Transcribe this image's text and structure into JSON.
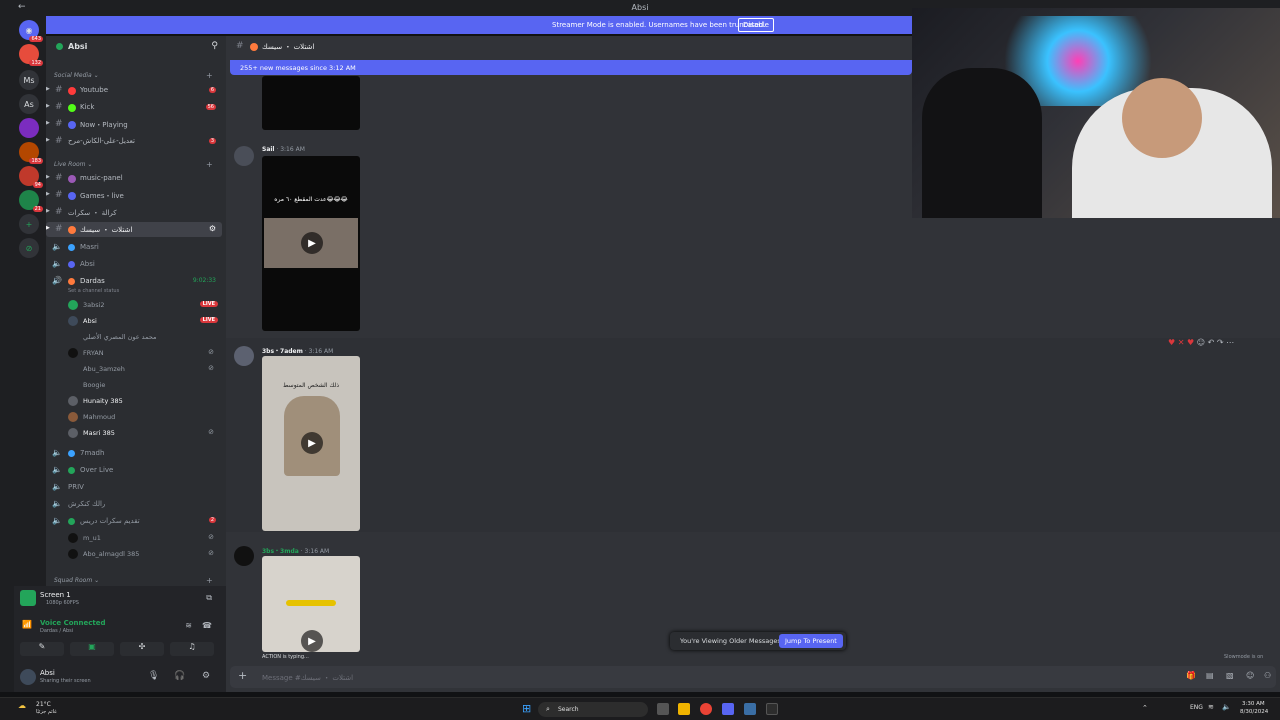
{
  "window": {
    "title": "Absi"
  },
  "streamer_mode": {
    "message": "Streamer Mode is enabled. Usernames have been truncated.",
    "button": "Disable"
  },
  "new_messages": "255+ new messages since 3:12 AM",
  "server_rail": [
    {
      "label": "",
      "badge": "643"
    },
    {
      "label": "",
      "badge": "132"
    },
    {
      "label": "Ms",
      "badge": ""
    },
    {
      "label": "As",
      "badge": ""
    },
    {
      "label": "",
      "badge": ""
    },
    {
      "label": "",
      "badge": "183"
    },
    {
      "label": "",
      "badge": "94"
    },
    {
      "label": "",
      "badge": "21"
    }
  ],
  "guild": {
    "name": "Absi"
  },
  "channels": {
    "cat_social": "Social Media",
    "social": [
      {
        "label": "Youtube",
        "badge": "6",
        "color": "#ff3b3b"
      },
      {
        "label": "Kick",
        "badge": "56",
        "color": "#53fc18"
      },
      {
        "label": "Now・Playing",
        "badge": "",
        "color": "#5865f2"
      },
      {
        "label": "تعديل-على-الكاش-مرح",
        "badge": "3",
        "color": "#8e9297"
      }
    ],
    "cat_live": "Live Room",
    "live": [
      {
        "label": "music-panel",
        "color": "#9b59b6"
      },
      {
        "label": "Games・live",
        "color": "#5865f2"
      },
      {
        "label": "كرالة ・ سكرات",
        "color": "#8e9297"
      },
      {
        "label": "اشتلات ・ سيسك",
        "color": "#ff7a3d",
        "active": true
      }
    ],
    "voice": [
      {
        "label": "Masri",
        "color": "#3ba2ff",
        "time": ""
      },
      {
        "label": "Absi",
        "color": "#5865f2",
        "time": ""
      },
      {
        "label": "Dardas",
        "color": "#ff7a3d",
        "time": "9:02:33"
      }
    ],
    "status_line": "Set a channel status",
    "users": [
      {
        "label": "3absi2",
        "live": "LIVE",
        "bright": false
      },
      {
        "label": "Absi",
        "live": "LIVE",
        "bright": true
      },
      {
        "label": "محمد عون المصري الأصلي",
        "live": "",
        "bright": false
      },
      {
        "label": "FRYAN",
        "live": "",
        "bright": false
      },
      {
        "label": "Abu_3amzeh",
        "live": "",
        "bright": false
      },
      {
        "label": "Boogie",
        "live": "",
        "bright": false
      },
      {
        "label": "Hunaity 385",
        "live": "",
        "bright": true
      },
      {
        "label": "Mahmoud",
        "live": "",
        "bright": false
      },
      {
        "label": "Masri 385",
        "live": "",
        "bright": true
      }
    ],
    "voice2": [
      {
        "label": "7madh",
        "color": "#3ba2ff"
      },
      {
        "label": "Over Live",
        "color": "#23a55a"
      },
      {
        "label": "PRIV",
        "color": "#8e9297"
      },
      {
        "label": "رالك كنكرش",
        "color": "#8e9297"
      },
      {
        "label": "تقديم سكرات دريس",
        "color": "#23a55a"
      }
    ],
    "users2": [
      {
        "label": "m_u1"
      },
      {
        "label": "Abo_almagdl 385"
      }
    ],
    "cat_squad": "Squad Room"
  },
  "voice_panel": {
    "screen_title": "Screen 1",
    "screen_sub": "1080p 60FPS",
    "connected": "Voice Connected",
    "connected_sub": "Dardas / Absi"
  },
  "user_panel": {
    "name": "Absi",
    "status": "Sharing their screen"
  },
  "channel_header": {
    "name": "اشتلات ・ سيسك"
  },
  "messages": [
    {
      "author": "Sail",
      "time": "3:16 AM",
      "caption": "عدت المقطع ٦٠ مره😂😂😂"
    },
    {
      "author": "3bs・7adem",
      "time": "3:16 AM",
      "caption": "ذلك الشخص المتوسط"
    },
    {
      "author": "3bs・3mda",
      "time": "3:16 AM",
      "caption": ""
    }
  ],
  "typing": "ACTION is typing...",
  "older_banner": {
    "text": "You're Viewing Older Messages",
    "button": "Jump To Present"
  },
  "slowmode": "Slowmode is on",
  "composer": {
    "placeholder": "Message #اشتلات ・ سيسك"
  },
  "taskbar": {
    "weather_temp": "21°C",
    "weather_text": "غائم جزئيًا",
    "search": "Search",
    "lang": "ENG",
    "time": "3:30 AM",
    "date": "8/30/2024"
  },
  "colors": {
    "accent": "#5865f2",
    "live": "#da373c",
    "online": "#23a55a"
  }
}
